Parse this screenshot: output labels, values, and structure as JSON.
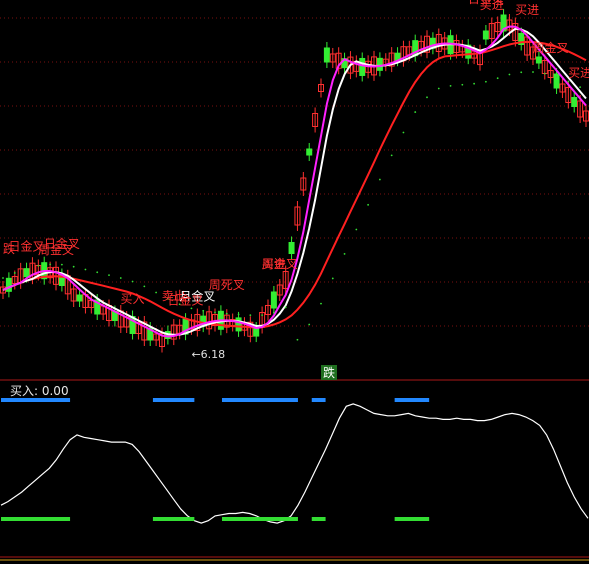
{
  "chart_data": [
    {
      "type": "candlestick",
      "panel": "main",
      "price_annotation": "6.18",
      "signals": [
        {
          "x": 4,
          "text": "日金叉",
          "color": "#ff3030"
        },
        {
          "x": 10,
          "text": "日金叉",
          "color": "#ff3030"
        },
        {
          "x": 9,
          "text": "周金叉",
          "color": "#ff3030"
        },
        {
          "x": 1,
          "text": "跌",
          "color": "#ff3030"
        },
        {
          "x": 22,
          "text": "买入",
          "color": "#ff3030"
        },
        {
          "x": 29,
          "text": "卖出",
          "color": "#ff3030"
        },
        {
          "x": 33,
          "text": "月金叉",
          "color": "#ffffff"
        },
        {
          "x": 38,
          "text": "周死叉",
          "color": "#ff3030"
        },
        {
          "x": 31,
          "text": "日金叉",
          "color": "#ff3030"
        },
        {
          "x": 46,
          "text": "买进",
          "color": "#ff3030"
        },
        {
          "x": 47,
          "text": "周金叉",
          "color": "#ff3030"
        },
        {
          "x": 82,
          "text": "日金叉",
          "color": "#ff3030"
        },
        {
          "x": 83,
          "text": "买进",
          "color": "#ff3030"
        },
        {
          "x": 89,
          "text": "买进",
          "color": "#ff3030"
        },
        {
          "x": 93,
          "text": "周金叉",
          "color": "#ff3030"
        },
        {
          "x": 98,
          "text": "买进",
          "color": "#ff3030"
        }
      ],
      "bottom_tag": "跌",
      "colors": {
        "up": "#32dcdc",
        "down": "#33ee33",
        "red_ma": "#ff2020",
        "white_ma": "#ffffff",
        "magenta_ma": "#ff22ff",
        "dotted_ma": "#33dd33"
      }
    },
    {
      "type": "line",
      "panel": "indicator",
      "title": "买入: 0.00",
      "series": [
        {
          "values": [
            15,
            18,
            22,
            26,
            31,
            36,
            41,
            46,
            53,
            62,
            70,
            74,
            72,
            71,
            70,
            69,
            68,
            68,
            68,
            66,
            60,
            52,
            44,
            36,
            28,
            20,
            12,
            6,
            2,
            0,
            2,
            6,
            7,
            8,
            8,
            9,
            8,
            6,
            3,
            1,
            0,
            2,
            6,
            15,
            26,
            38,
            50,
            62,
            75,
            88,
            98,
            100,
            98,
            95,
            92,
            91,
            90,
            90,
            91,
            92,
            90,
            89,
            88,
            88,
            87,
            87,
            88,
            87,
            87,
            86,
            86,
            87,
            89,
            91,
            92,
            91,
            89,
            86,
            82,
            74,
            62,
            48,
            34,
            22,
            12,
            4
          ]
        }
      ],
      "ylim": [
        -10,
        110
      ],
      "band_segments": [
        [
          0,
          10
        ],
        [
          22,
          28
        ],
        [
          32,
          43
        ],
        [
          45,
          47
        ],
        [
          57,
          62
        ]
      ],
      "colors": {
        "top_band": "#2288ff",
        "bottom_band": "#33dd33",
        "line": "#ffffff"
      }
    }
  ]
}
